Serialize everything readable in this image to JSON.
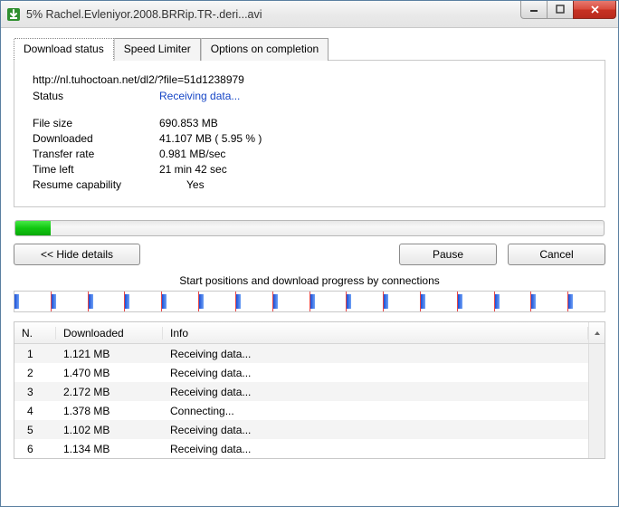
{
  "window": {
    "title": "5% Rachel.Evleniyor.2008.BRRip.TR-.deri...avi"
  },
  "tabs": {
    "download_status": "Download status",
    "speed_limiter": "Speed Limiter",
    "options_on_completion": "Options on completion"
  },
  "info": {
    "url": "http://nl.tuhoctoan.net/dl2/?file=51d1238979",
    "status_label": "Status",
    "status_value": "Receiving data...",
    "filesize_label": "File size",
    "filesize_value": "690.853  MB",
    "downloaded_label": "Downloaded",
    "downloaded_value": "41.107  MB  ( 5.95 % )",
    "transferrate_label": "Transfer rate",
    "transferrate_value": "0.981  MB/sec",
    "timeleft_label": "Time left",
    "timeleft_value": "21 min 42 sec",
    "resume_label": "Resume capability",
    "resume_value": "Yes"
  },
  "progress_percent": 5.95,
  "buttons": {
    "hide_details": "<< Hide details",
    "pause": "Pause",
    "cancel": "Cancel"
  },
  "segments_label": "Start positions and download progress by connections",
  "table": {
    "headers": {
      "n": "N.",
      "downloaded": "Downloaded",
      "info": "Info"
    },
    "rows": [
      {
        "n": "1",
        "downloaded": "1.121  MB",
        "info": "Receiving data..."
      },
      {
        "n": "2",
        "downloaded": "1.470  MB",
        "info": "Receiving data..."
      },
      {
        "n": "3",
        "downloaded": "2.172  MB",
        "info": "Receiving data..."
      },
      {
        "n": "4",
        "downloaded": "1.378  MB",
        "info": "Connecting..."
      },
      {
        "n": "5",
        "downloaded": "1.102  MB",
        "info": "Receiving data..."
      },
      {
        "n": "6",
        "downloaded": "1.134  MB",
        "info": "Receiving data..."
      }
    ]
  }
}
